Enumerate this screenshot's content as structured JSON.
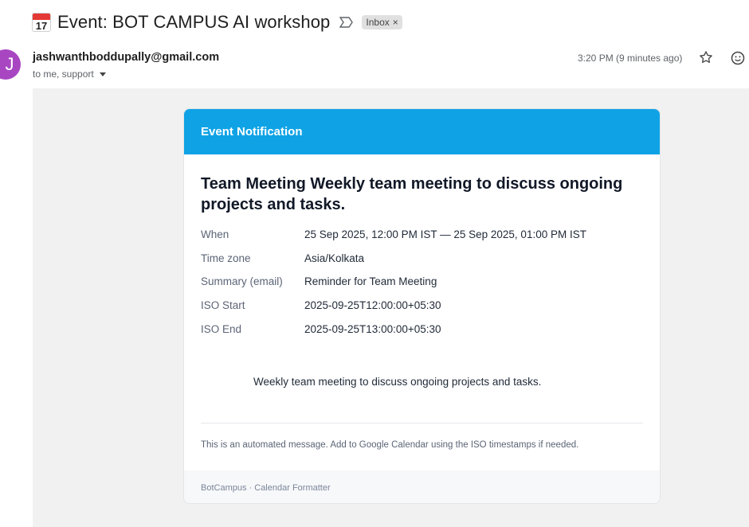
{
  "subject": {
    "calendar_emoji_day": "17",
    "title": "Event: BOT CAMPUS AI workshop",
    "label_chip": "Inbox",
    "label_chip_close": "×"
  },
  "sender": {
    "avatar_letter": "J",
    "email": "jashwanthboddupally@gmail.com",
    "recipients": "to me, support"
  },
  "meta": {
    "time": "3:20 PM (9 minutes ago)"
  },
  "icons": {
    "important": "important-marker-icon",
    "star": "star-icon",
    "emoji": "emoji-reaction-icon"
  },
  "card": {
    "header": "Event Notification",
    "title": "Team Meeting Weekly team meeting to discuss ongoing projects and tasks.",
    "details": [
      {
        "label": "When",
        "value": "25 Sep 2025, 12:00 PM IST — 25 Sep 2025, 01:00 PM IST"
      },
      {
        "label": "Time zone",
        "value": "Asia/Kolkata"
      },
      {
        "label": "Summary (email)",
        "value": "Reminder for Team Meeting"
      },
      {
        "label": "ISO Start",
        "value": "2025-09-25T12:00:00+05:30"
      },
      {
        "label": "ISO End",
        "value": "2025-09-25T13:00:00+05:30"
      }
    ],
    "description": "Weekly team meeting to discuss ongoing projects and tasks.",
    "automated_note": "This is an automated message. Add to Google Calendar using the ISO timestamps if needed.",
    "footer": "BotCampus · Calendar Formatter"
  },
  "colors": {
    "header_blue": "#0fa3e6",
    "avatar_purple": "#a846c2",
    "body_bg": "#f1f1f1"
  }
}
